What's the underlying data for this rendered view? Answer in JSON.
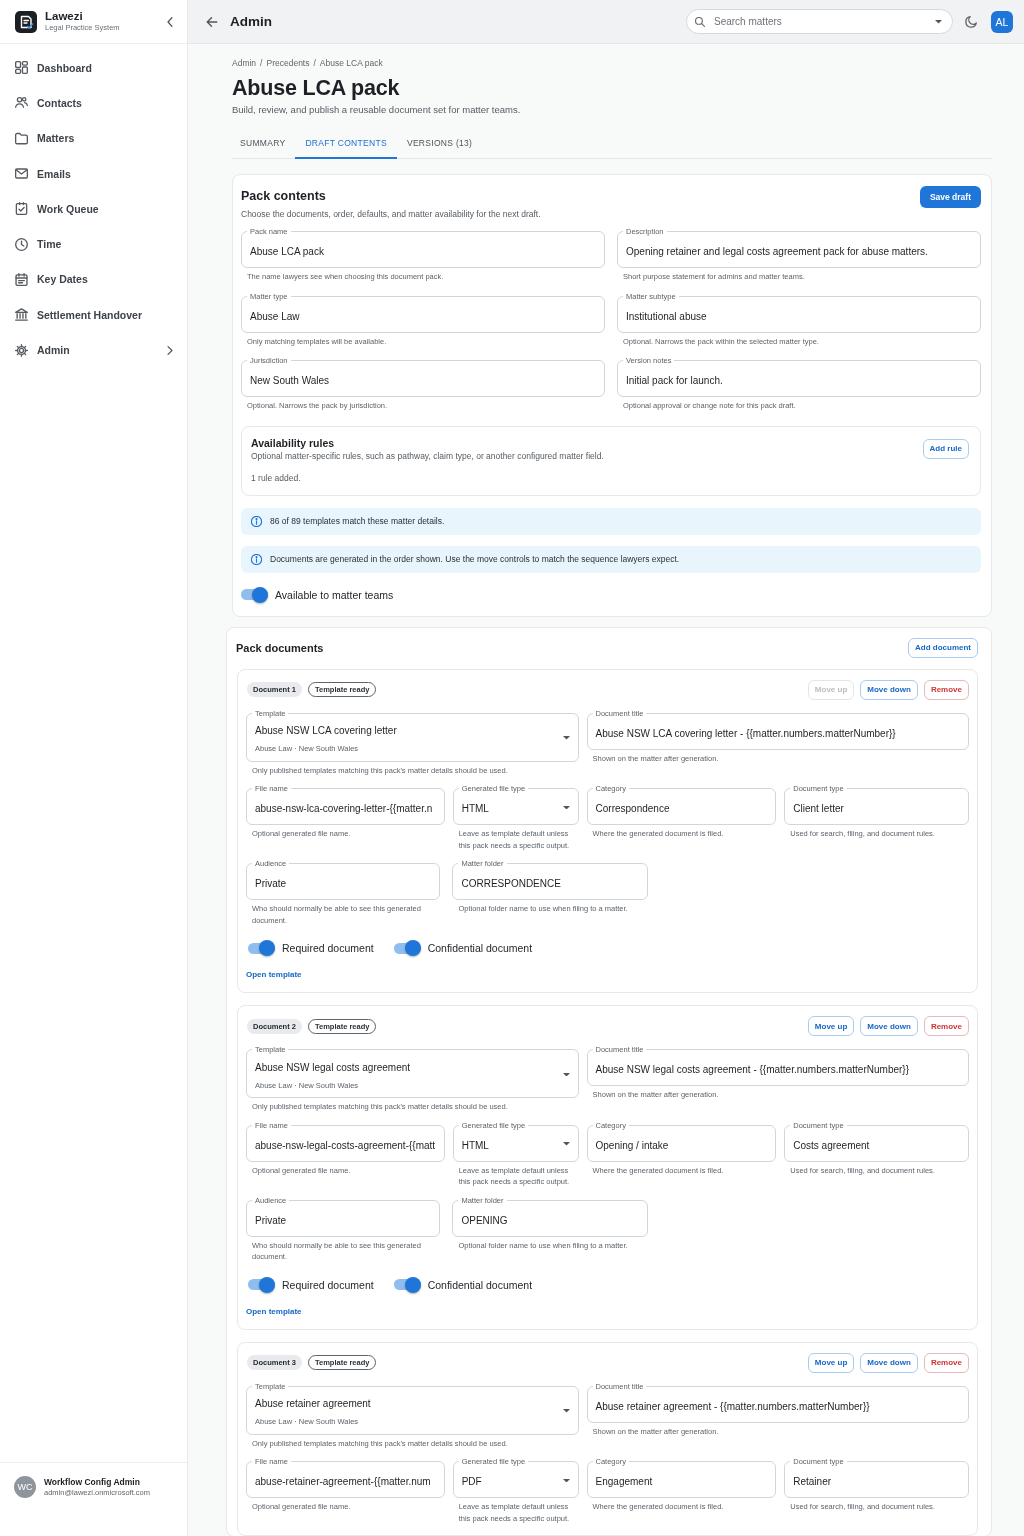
{
  "sidebar": {
    "brand": {
      "name": "Lawezi",
      "tagline": "Legal Practice System"
    },
    "items": [
      {
        "label": "Dashboard",
        "selected": false,
        "expandable": false
      },
      {
        "label": "Contacts",
        "selected": false,
        "expandable": false
      },
      {
        "label": "Matters",
        "selected": false,
        "expandable": false
      },
      {
        "label": "Emails",
        "selected": false,
        "expandable": false
      },
      {
        "label": "Work Queue",
        "selected": false,
        "expandable": false
      },
      {
        "label": "Time",
        "selected": false,
        "expandable": false
      },
      {
        "label": "Key Dates",
        "selected": false,
        "expandable": false
      },
      {
        "label": "Settlement Handover",
        "selected": false,
        "expandable": false
      },
      {
        "label": "Admin",
        "selected": false,
        "expandable": true
      }
    ],
    "user": {
      "initials": "WC",
      "name": "Workflow Config Admin",
      "email": "admin@lawezi.onmicrosoft.com"
    }
  },
  "header": {
    "title": "Admin",
    "search": {
      "placeholder": "Search matters"
    },
    "avatar": "AL"
  },
  "page": {
    "breadcrumb": {
      "items": [
        "Admin",
        "Precedents",
        "Abuse LCA pack"
      ],
      "separator": "/"
    },
    "title": "Abuse LCA pack",
    "subtitle": "Build, review, and publish a reusable document set for matter teams.",
    "tabs": [
      {
        "label": "SUMMARY",
        "selected": false
      },
      {
        "label": "DRAFT CONTENTS",
        "selected": true
      },
      {
        "label": "VERSIONS (13)",
        "selected": false
      }
    ]
  },
  "pack_contents": {
    "title": "Pack contents",
    "subtitle": "Choose the documents, order, defaults, and matter availability for the next draft.",
    "save_button": "Save draft",
    "fields": [
      {
        "label": "Pack name",
        "value": "Abuse LCA pack",
        "helper": "The name lawyers see when choosing this document pack."
      },
      {
        "label": "Description",
        "value": "Opening retainer and legal costs agreement pack for abuse matters.",
        "helper": "Short purpose statement for admins and matter teams."
      },
      {
        "label": "Matter type",
        "value": "Abuse Law",
        "helper": "Only matching templates will be available."
      },
      {
        "label": "Matter subtype",
        "value": "Institutional abuse",
        "helper": "Optional. Narrows the pack within the selected matter type."
      },
      {
        "label": "Jurisdiction",
        "value": "New South Wales",
        "helper": "Optional. Narrows the pack by jurisdiction."
      },
      {
        "label": "Version notes",
        "value": "Initial pack for launch.",
        "helper": "Optional approval or change note for this pack draft."
      }
    ],
    "availability": {
      "title": "Availability rules",
      "description": "Optional matter-specific rules, such as pathway, claim type, or another configured matter field.",
      "status": "1 rule added.",
      "button": "Add rule"
    },
    "alerts": [
      "86 of 89 templates match these matter details.",
      "Documents are generated in the order shown. Use the move controls to match the sequence lawyers expect."
    ],
    "available_toggle": {
      "label": "Available to matter teams",
      "on": true
    }
  },
  "pack_documents": {
    "title": "Pack documents",
    "add_button": "Add document",
    "documents": [
      {
        "number": "Document 1",
        "status": "Template ready",
        "actions": [
          {
            "label": "Move up",
            "kind": "move",
            "disabled": true
          },
          {
            "label": "Move down",
            "kind": "move",
            "disabled": false
          },
          {
            "label": "Remove",
            "kind": "remove",
            "disabled": false
          }
        ],
        "fields": [
          {
            "kind": "select",
            "label": "Template",
            "value": "Abuse NSW LCA covering letter",
            "secondary": "Abuse Law · New South Wales",
            "helper": "Only published templates matching this pack's matter details should be used."
          },
          {
            "kind": "text",
            "label": "Document title",
            "value": "Abuse NSW LCA covering letter - {{matter.numbers.matterNumber}}",
            "helper": "Shown on the matter after generation."
          },
          {
            "kind": "text",
            "label": "File name",
            "value": "abuse-nsw-lca-covering-letter-{{matter.n",
            "helper": "Optional generated file name."
          },
          {
            "kind": "select",
            "label": "Generated file type",
            "value": "HTML",
            "helper": "Leave as template default unless this pack needs a specific output."
          },
          {
            "kind": "text",
            "label": "Category",
            "value": "Correspondence",
            "helper": "Where the generated document is filed."
          },
          {
            "kind": "text",
            "label": "Document type",
            "value": "Client letter",
            "helper": "Used for search, filing, and document rules."
          },
          {
            "kind": "text",
            "label": "Audience",
            "value": "Private",
            "helper": "Who should normally be able to see this generated document."
          },
          {
            "kind": "text",
            "label": "Matter folder",
            "value": "CORRESPONDENCE",
            "helper": "Optional folder name to use when filing to a matter."
          }
        ],
        "toggles": [
          {
            "label": "Required document",
            "on": true
          },
          {
            "label": "Confidential document",
            "on": true
          }
        ],
        "link": "Open template"
      },
      {
        "number": "Document 2",
        "status": "Template ready",
        "actions": [
          {
            "label": "Move up",
            "kind": "move",
            "disabled": false
          },
          {
            "label": "Move down",
            "kind": "move",
            "disabled": false
          },
          {
            "label": "Remove",
            "kind": "remove",
            "disabled": false
          }
        ],
        "fields": [
          {
            "kind": "select",
            "label": "Template",
            "value": "Abuse NSW legal costs agreement",
            "secondary": "Abuse Law · New South Wales",
            "helper": "Only published templates matching this pack's matter details should be used."
          },
          {
            "kind": "text",
            "label": "Document title",
            "value": "Abuse NSW legal costs agreement - {{matter.numbers.matterNumber}}",
            "helper": "Shown on the matter after generation."
          },
          {
            "kind": "text",
            "label": "File name",
            "value": "abuse-nsw-legal-costs-agreement-{{matt",
            "helper": "Optional generated file name."
          },
          {
            "kind": "select",
            "label": "Generated file type",
            "value": "HTML",
            "helper": "Leave as template default unless this pack needs a specific output."
          },
          {
            "kind": "text",
            "label": "Category",
            "value": "Opening / intake",
            "helper": "Where the generated document is filed."
          },
          {
            "kind": "text",
            "label": "Document type",
            "value": "Costs agreement",
            "helper": "Used for search, filing, and document rules."
          },
          {
            "kind": "text",
            "label": "Audience",
            "value": "Private",
            "helper": "Who should normally be able to see this generated document."
          },
          {
            "kind": "text",
            "label": "Matter folder",
            "value": "OPENING",
            "helper": "Optional folder name to use when filing to a matter."
          }
        ],
        "toggles": [
          {
            "label": "Required document",
            "on": true
          },
          {
            "label": "Confidential document",
            "on": true
          }
        ],
        "link": "Open template"
      },
      {
        "number": "Document 3",
        "status": "Template ready",
        "actions": [
          {
            "label": "Move up",
            "kind": "move",
            "disabled": false
          },
          {
            "label": "Move down",
            "kind": "move",
            "disabled": false
          },
          {
            "label": "Remove",
            "kind": "remove",
            "disabled": false
          }
        ],
        "fields": [
          {
            "kind": "select",
            "label": "Template",
            "value": "Abuse retainer agreement",
            "secondary": "Abuse Law · New South Wales",
            "helper": "Only published templates matching this pack's matter details should be used."
          },
          {
            "kind": "text",
            "label": "Document title",
            "value": "Abuse retainer agreement - {{matter.numbers.matterNumber}}",
            "helper": "Shown on the matter after generation."
          },
          {
            "kind": "text",
            "label": "File name",
            "value": "abuse-retainer-agreement-{{matter.num",
            "helper": "Optional generated file name."
          },
          {
            "kind": "select",
            "label": "Generated file type",
            "value": "PDF",
            "helper": "Leave as template default unless this pack needs a specific output."
          },
          {
            "kind": "text",
            "label": "Category",
            "value": "Engagement",
            "helper": "Where the generated document is filed."
          },
          {
            "kind": "text",
            "label": "Document type",
            "value": "Retainer",
            "helper": "Used for search, filing, and document rules."
          }
        ]
      }
    ]
  }
}
